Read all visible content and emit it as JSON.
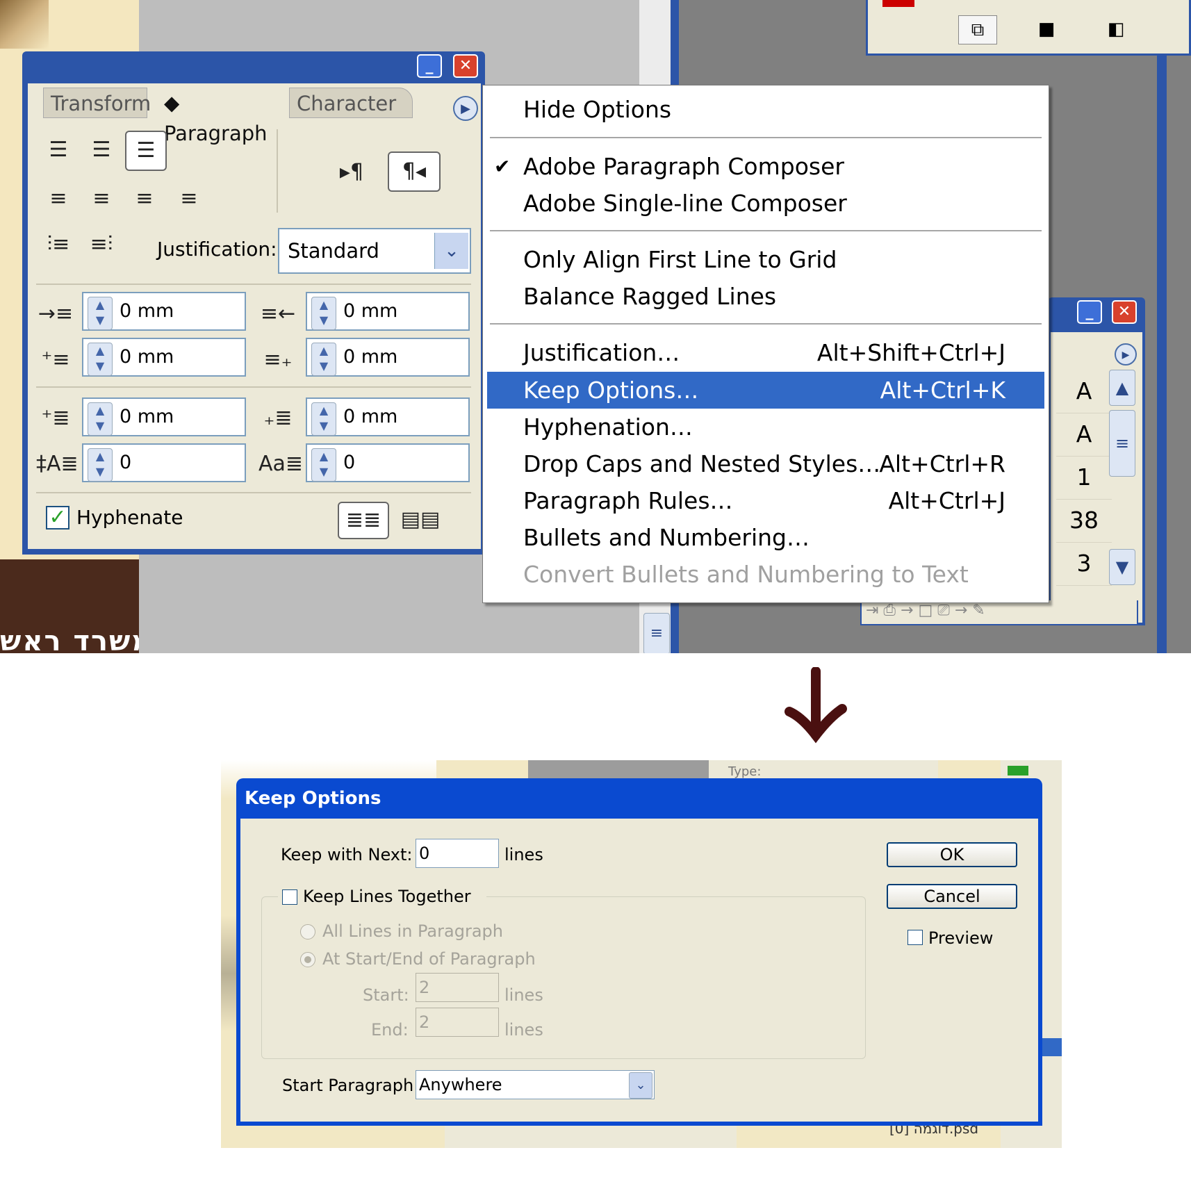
{
  "paragraph_panel": {
    "tabs": [
      "Transform",
      "◆ Paragraph",
      "Character"
    ],
    "justification_label": "Justification:",
    "justification_value": "Standard",
    "left_indent": "0 mm",
    "right_indent": "0 mm",
    "first_line_indent": "0 mm",
    "last_line_indent": "0 mm",
    "space_before": "0 mm",
    "space_after": "0 mm",
    "drop_cap_lines": "0",
    "drop_cap_chars": "0",
    "hyphenate_label": "Hyphenate",
    "hyphenate_checked": true
  },
  "menu": {
    "hide_options": "Hide Options",
    "paragraph_composer": "Adobe Paragraph Composer",
    "single_line_composer": "Adobe Single-line Composer",
    "only_align_first": "Only Align First Line to Grid",
    "balance_ragged": "Balance Ragged Lines",
    "justification": "Justification…",
    "justification_shortcut": "Alt+Shift+Ctrl+J",
    "keep_options": "Keep Options…",
    "keep_options_shortcut": "Alt+Ctrl+K",
    "hyphenation": "Hyphenation…",
    "drop_caps": "Drop Caps and Nested Styles…",
    "drop_caps_shortcut": "Alt+Ctrl+R",
    "paragraph_rules": "Paragraph Rules…",
    "paragraph_rules_shortcut": "Alt+Ctrl+J",
    "bullets": "Bullets and Numbering…",
    "convert_bullets": "Convert Bullets and Numbering to Text",
    "checkmark": "✔"
  },
  "side_panel": {
    "cells": [
      "A",
      "A",
      "1",
      "38",
      "3"
    ]
  },
  "background": {
    "hebrew_text": "משרד ראש"
  },
  "keep_options_dialog": {
    "title": "Keep Options",
    "keep_with_next_label": "Keep with Next:",
    "keep_with_next_value": "0",
    "lines_unit": "lines",
    "keep_lines_together_label": "Keep Lines Together",
    "all_lines_label": "All Lines in Paragraph",
    "at_start_end_label": "At Start/End of Paragraph",
    "start_label": "Start:",
    "start_value": "2",
    "end_label": "End:",
    "end_value": "2",
    "start_paragraph_label": "Start Paragraph:",
    "start_paragraph_value": "Anywhere",
    "ok_label": "OK",
    "cancel_label": "Cancel",
    "preview_label": "Preview"
  },
  "bottom_bg": {
    "type_label": "Type:",
    "filename": "[0] דוגמה.psd"
  },
  "colors": {
    "xp_blue": "#2c55a8",
    "menu_highlight": "#3169c6",
    "dialog_title": "#0a4ad0",
    "arrow": "#4a1010"
  }
}
